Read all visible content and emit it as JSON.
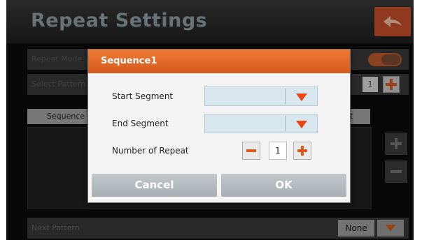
{
  "header": {
    "title": "Repeat Settings",
    "back_icon": "back-arrow-icon"
  },
  "background": {
    "repeat_mode_label": "Repeat Mode",
    "select_pattern_label": "Select Pattern",
    "select_pattern_value": "1",
    "sequence_tab_label": "Sequence",
    "right_tab_label": "nt",
    "next_pattern_label": "Next Pattern",
    "next_pattern_value": "None"
  },
  "dialog": {
    "title": "Sequence1",
    "start_segment_label": "Start Segment",
    "end_segment_label": "End Segment",
    "number_of_repeat_label": "Number of Repeat",
    "number_of_repeat_value": "1",
    "cancel_label": "Cancel",
    "ok_label": "OK"
  },
  "colors": {
    "accent": "#d9591f",
    "dialog_header": "#e56a28",
    "button_grey": "#b4bbc0",
    "combo_fill": "#d8e6ee"
  }
}
